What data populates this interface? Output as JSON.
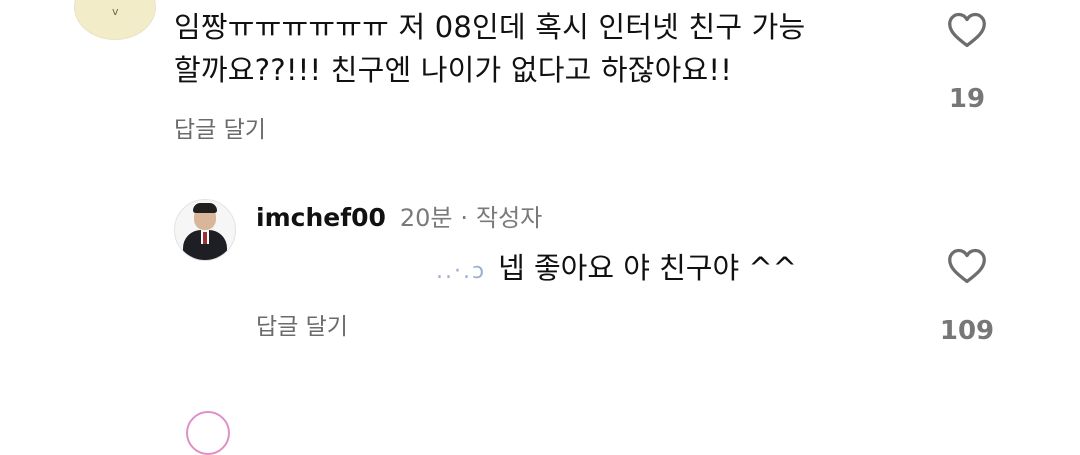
{
  "comments": [
    {
      "text_lines": [
        "임짱ㅠㅠㅠㅠㅠㅠ 저 08인데 혹시 인터넷 친구 가능",
        "할까요??!!! 친구엔 나이가 없다고 하잖아요!!"
      ],
      "reply_label": "답글 달기",
      "like_count": "19",
      "avatar_icon": "chick-character-avatar",
      "replies": [
        {
          "username": "imchef00",
          "time": "20분",
          "separator": "·",
          "author_tag": "작성자",
          "mention": "..·.ɔ",
          "text": "넵  좋아요 야 친구야 ^^",
          "reply_label": "답글 달기",
          "like_count": "109",
          "avatar_icon": "chef-profile-avatar"
        }
      ]
    }
  ],
  "icons": {
    "like": "heart-outline-icon"
  },
  "colors": {
    "text": "#111111",
    "secondary": "#6b6b6b",
    "count": "#777777"
  }
}
